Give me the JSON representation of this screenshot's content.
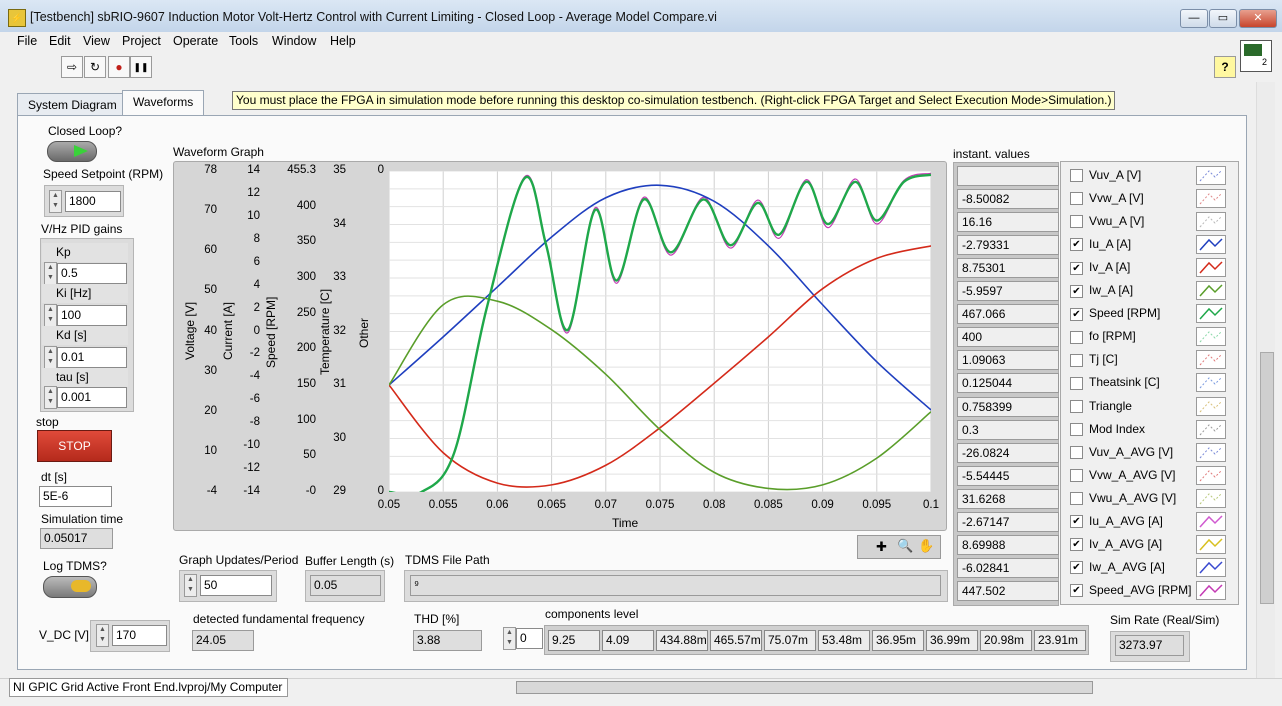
{
  "window": {
    "title": "[Testbench] sbRIO-9607 Induction Motor Volt-Hertz Control with Current Limiting - Closed Loop - Average Model Compare.vi",
    "minimize": "—",
    "restore": "▭",
    "close": "✕"
  },
  "menu": [
    "File",
    "Edit",
    "View",
    "Project",
    "Operate",
    "Tools",
    "Window",
    "Help"
  ],
  "toolbar": {
    "run_arrow": "⇨",
    "run_continuous": "↻",
    "abort": "●",
    "pause": "❚❚",
    "help": "?",
    "connector_badge": "2"
  },
  "tabs": [
    "System Diagram",
    "Waveforms"
  ],
  "active_tab": "Waveforms",
  "warning": "You must place the FPGA in simulation mode before running this desktop co-simulation testbench. (Right-click FPGA Target and Select Execution Mode>Simulation.)",
  "left_panel": {
    "closed_loop_label": "Closed Loop?",
    "speed_setpoint_label": "Speed Setpoint (RPM)",
    "speed_setpoint_value": "1800",
    "pid_label": "V/Hz PID gains",
    "kp_label": "Kp",
    "kp_value": "0.5",
    "ki_label": "Ki [Hz]",
    "ki_value": "100",
    "kd_label": "Kd [s]",
    "kd_value": "0.01",
    "tau_label": "tau [s]",
    "tau_value": "0.001",
    "stop_label": "stop",
    "stop_button": "STOP",
    "dt_label": "dt [s]",
    "dt_value": "5E-6",
    "simtime_label": "Simulation time",
    "simtime_value": "0.05017",
    "logtdms_label": "Log TDMS?",
    "vdc_label": "V_DC [V]",
    "vdc_value": "170"
  },
  "graph": {
    "title": "Waveform Graph",
    "axes": [
      {
        "name": "Voltage [V]",
        "ticks": [
          "78",
          "70",
          "60",
          "50",
          "40",
          "30",
          "20",
          "10",
          "-4"
        ]
      },
      {
        "name": "Current [A]",
        "ticks": [
          "14",
          "12",
          "10",
          "8",
          "6",
          "4",
          "2",
          "0",
          "-2",
          "-4",
          "-6",
          "-8",
          "-10",
          "-12",
          "-14"
        ]
      },
      {
        "name": "Speed [RPM]",
        "ticks": [
          "455.3",
          "400",
          "350",
          "300",
          "250",
          "200",
          "150",
          "100",
          "50",
          "-0"
        ]
      },
      {
        "name": "Temperature [C]",
        "ticks": [
          "35",
          "34",
          "33",
          "32",
          "31",
          "30",
          "29"
        ]
      },
      {
        "name": "Other",
        "ticks": [
          "0",
          "0"
        ]
      }
    ],
    "x_ticks": [
      "0.05",
      "0.055",
      "0.06",
      "0.065",
      "0.07",
      "0.075",
      "0.08",
      "0.085",
      "0.09",
      "0.095",
      "0.1"
    ],
    "x_label": "Time",
    "palette_icons": [
      "crosshair-icon",
      "zoom-icon",
      "pan-hand-icon"
    ]
  },
  "chart_data": {
    "type": "line",
    "xlabel": "Time",
    "xlim": [
      0.05,
      0.1
    ],
    "ylabel": "Current [A]",
    "ylim": [
      -4,
      14
    ],
    "series": [
      {
        "name": "Iu_A [A]",
        "color": "#1f3fbf",
        "x": [
          0.05,
          0.055,
          0.06,
          0.065,
          0.07,
          0.075,
          0.08,
          0.085,
          0.09,
          0.095,
          0.1
        ],
        "values": [
          2.0,
          4.7,
          7.5,
          10.3,
          12.5,
          13.2,
          12.3,
          9.8,
          6.5,
          3.3,
          0.6
        ]
      },
      {
        "name": "Iv_A [A]",
        "color": "#d42a1a",
        "x": [
          0.05,
          0.055,
          0.06,
          0.065,
          0.07,
          0.075,
          0.08,
          0.085,
          0.09,
          0.095,
          0.1
        ],
        "values": [
          2.0,
          -1.8,
          -3.5,
          -3.6,
          -2.5,
          -0.4,
          2.1,
          4.7,
          7.4,
          9.1,
          9.8
        ]
      },
      {
        "name": "Iw_A [A]",
        "color": "#5a9e2a",
        "x": [
          0.05,
          0.055,
          0.06,
          0.065,
          0.07,
          0.075,
          0.08,
          0.085,
          0.09,
          0.095,
          0.1
        ],
        "values": [
          2.0,
          6.5,
          6.7,
          5.1,
          2.6,
          -0.5,
          -2.9,
          -3.8,
          -3.6,
          -2.1,
          0.5
        ]
      },
      {
        "name": "Speed [RPM]",
        "color": "#1fa84a",
        "x": [
          0.05,
          0.053,
          0.056,
          0.059,
          0.0625,
          0.0645,
          0.0665,
          0.069,
          0.071,
          0.0735,
          0.076,
          0.079,
          0.0815,
          0.084,
          0.086,
          0.0885,
          0.0905,
          0.093,
          0.095,
          0.0975,
          0.1
        ],
        "values": [
          0,
          0,
          55,
          260,
          445,
          350,
          230,
          400,
          300,
          415,
          340,
          415,
          350,
          410,
          365,
          440,
          380,
          440,
          385,
          440,
          450
        ]
      },
      {
        "name": "Speed_AVG [RPM]",
        "color": "#c43ab4",
        "x": [
          0.05,
          0.053,
          0.056,
          0.059,
          0.0625,
          0.0645,
          0.0665,
          0.069,
          0.071,
          0.0735,
          0.076,
          0.079,
          0.0815,
          0.084,
          0.086,
          0.0885,
          0.0905,
          0.093,
          0.095,
          0.0975,
          0.1
        ],
        "values": [
          0,
          0,
          55,
          260,
          447,
          352,
          226,
          403,
          296,
          418,
          336,
          418,
          346,
          414,
          360,
          443,
          375,
          444,
          380,
          442,
          452
        ]
      }
    ],
    "grid": true
  },
  "instant_values": {
    "label": "instant. values",
    "values": [
      "",
      "-8.50082",
      "16.16",
      "-2.79331",
      "8.75301",
      "-5.9597",
      "467.066",
      "400",
      "1.09063",
      "0.125044",
      "0.758399",
      "0.3",
      "-26.0824",
      "-5.54445",
      "31.6268",
      "-2.67147",
      "8.69988",
      "-6.02841",
      "447.502"
    ]
  },
  "legend": [
    {
      "label": "Vuv_A [V]",
      "checked": false,
      "color": "#7a8ad8"
    },
    {
      "label": "Vvw_A [V]",
      "checked": false,
      "color": "#e08a8a"
    },
    {
      "label": "Vwu_A [V]",
      "checked": false,
      "color": "#b8b8b8"
    },
    {
      "label": "Iu_A [A]",
      "checked": true,
      "color": "#1f3fbf"
    },
    {
      "label": "Iv_A [A]",
      "checked": true,
      "color": "#d42a1a"
    },
    {
      "label": "Iw_A [A]",
      "checked": true,
      "color": "#5a9e2a"
    },
    {
      "label": "Speed [RPM]",
      "checked": true,
      "color": "#1fa84a"
    },
    {
      "label": "fo [RPM]",
      "checked": false,
      "color": "#8ad8a8"
    },
    {
      "label": "Tj [C]",
      "checked": false,
      "color": "#e07a7a"
    },
    {
      "label": "Theatsink [C]",
      "checked": false,
      "color": "#7a9ae0"
    },
    {
      "label": "Triangle",
      "checked": false,
      "color": "#d8c07a"
    },
    {
      "label": "Mod Index",
      "checked": false,
      "color": "#9a9a9a"
    },
    {
      "label": "Vuv_A_AVG [V]",
      "checked": false,
      "color": "#7a8ad8"
    },
    {
      "label": "Vvw_A_AVG [V]",
      "checked": false,
      "color": "#e07a7a"
    },
    {
      "label": "Vwu_A_AVG [V]",
      "checked": false,
      "color": "#b8c87a"
    },
    {
      "label": "Iu_A_AVG [A]",
      "checked": true,
      "color": "#d05ad0"
    },
    {
      "label": "Iv_A_AVG [A]",
      "checked": true,
      "color": "#d8c020"
    },
    {
      "label": "Iw_A_AVG [A]",
      "checked": true,
      "color": "#3a4ad0"
    },
    {
      "label": "Speed_AVG [RPM]",
      "checked": true,
      "color": "#c43ab4"
    }
  ],
  "bottom": {
    "graph_updates_label": "Graph Updates/Period",
    "graph_updates_value": "50",
    "buffer_length_label": "Buffer Length (s)",
    "buffer_length_value": "0.05",
    "tdms_path_label": "TDMS File Path",
    "tdms_path_value": "⁹",
    "fund_freq_label": "detected fundamental frequency",
    "fund_freq_value": "24.05",
    "thd_label": "THD [%]",
    "thd_value": "3.88",
    "components_label": "components level",
    "components_index": "0",
    "components": [
      "9.25",
      "4.09",
      "434.88m",
      "465.57m",
      "75.07m",
      "53.48m",
      "36.95m",
      "36.99m",
      "20.98m",
      "23.91m"
    ],
    "sim_rate_label": "Sim Rate (Real/Sim)",
    "sim_rate_value": "3273.97"
  },
  "statusbar": {
    "path": "NI GPIC Grid Active Front End.lvproj/My Computer"
  }
}
